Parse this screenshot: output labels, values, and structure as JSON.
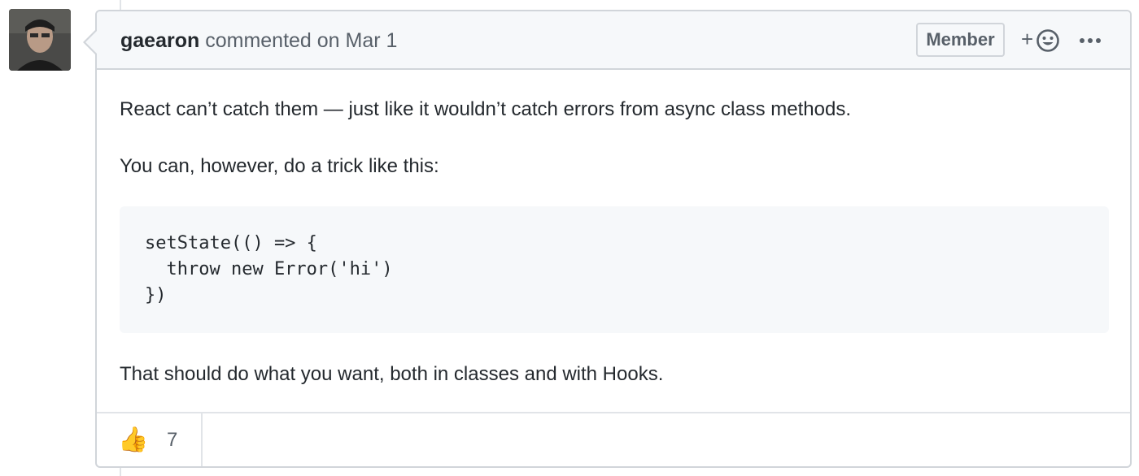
{
  "comment": {
    "author": "gaearon",
    "action_text": "commented on Mar 1",
    "badge": "Member",
    "react_plus": "+",
    "paragraphs": [
      "React can’t catch them — just like it wouldn’t catch errors from async class methods.",
      "You can, however, do a trick like this:",
      "That should do what you want, both in classes and with Hooks."
    ],
    "code": "setState(() => {\n  throw new Error('hi')\n})",
    "reactions": [
      {
        "emoji": "👍",
        "count": "7"
      }
    ]
  },
  "icons": [
    "avatar",
    "smiley-icon",
    "kebab-menu-icon",
    "thumbs-up-icon"
  ],
  "colors": {
    "header_bg": "#f6f8fa",
    "border": "#d1d5da",
    "muted_text": "#586069",
    "code_bg": "#f6f8fa"
  }
}
